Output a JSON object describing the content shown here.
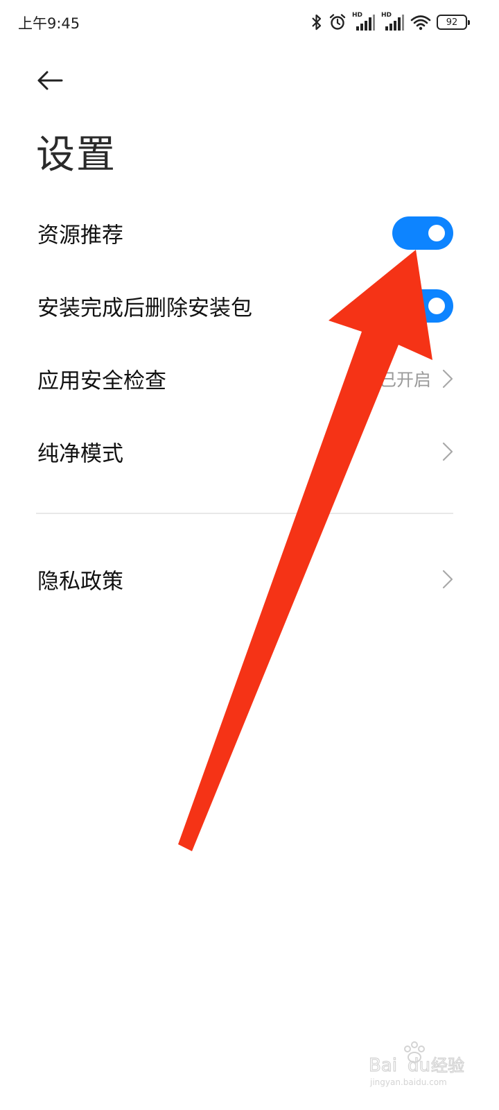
{
  "status_bar": {
    "time": "上午9:45",
    "network_label_1": "HD",
    "network_label_2": "HD",
    "battery": "92",
    "icons": [
      "bluetooth-icon",
      "alarm-icon",
      "signal-icon",
      "signal-icon",
      "wifi-icon",
      "battery-icon"
    ]
  },
  "header": {
    "back_icon": "arrow-left-icon",
    "title": "设置"
  },
  "settings": {
    "items": [
      {
        "label": "资源推荐",
        "type": "toggle",
        "on": true
      },
      {
        "label": "安装完成后删除安装包",
        "type": "toggle",
        "on": true
      },
      {
        "label": "应用安全检查",
        "type": "link",
        "value": "已开启"
      },
      {
        "label": "纯净模式",
        "type": "link",
        "value": ""
      }
    ],
    "privacy": {
      "label": "隐私政策",
      "type": "link"
    }
  },
  "colors": {
    "accent": "#0d84ff",
    "annotation_arrow": "#f53316",
    "divider": "#e8e8e8",
    "secondary_text": "#9a9a9a"
  },
  "watermark": {
    "text": "Baidu经验",
    "url_text": "jingyan.baidu.com"
  }
}
